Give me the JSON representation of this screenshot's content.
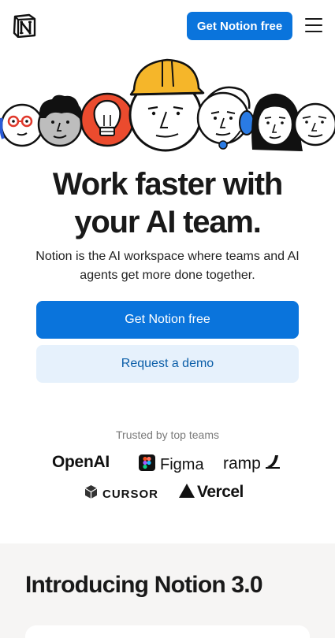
{
  "header": {
    "logo_icon": "notion-logo-icon",
    "cta_label": "Get Notion free",
    "menu_icon": "hamburger-menu-icon"
  },
  "hero": {
    "illustration_icon": "ai-team-faces-illustration",
    "title_line1": "Work faster with",
    "title_line2": "your AI team.",
    "subtitle": "Notion is the AI workspace where teams and AI agents get more done together.",
    "primary_cta": "Get Notion free",
    "secondary_cta": "Request a demo"
  },
  "trusted": {
    "label": "Trusted by top teams",
    "logos": [
      {
        "name": "OpenAI",
        "icon": "openai-logo"
      },
      {
        "name": "Figma",
        "icon": "figma-logo"
      },
      {
        "name": "ramp",
        "icon": "ramp-logo"
      },
      {
        "name": "CURSOR",
        "icon": "cursor-logo"
      },
      {
        "name": "Vercel",
        "icon": "vercel-logo"
      }
    ]
  },
  "intro": {
    "title": "Introducing Notion 3.0"
  },
  "colors": {
    "brand_blue": "#0a74dc",
    "secondary_bg": "#e6f1fc",
    "secondary_text": "#0b5ea8",
    "section_bg": "#f6f5f4",
    "hardhat_yellow": "#f5b62a",
    "lightbulb_red": "#eb4b2e"
  }
}
